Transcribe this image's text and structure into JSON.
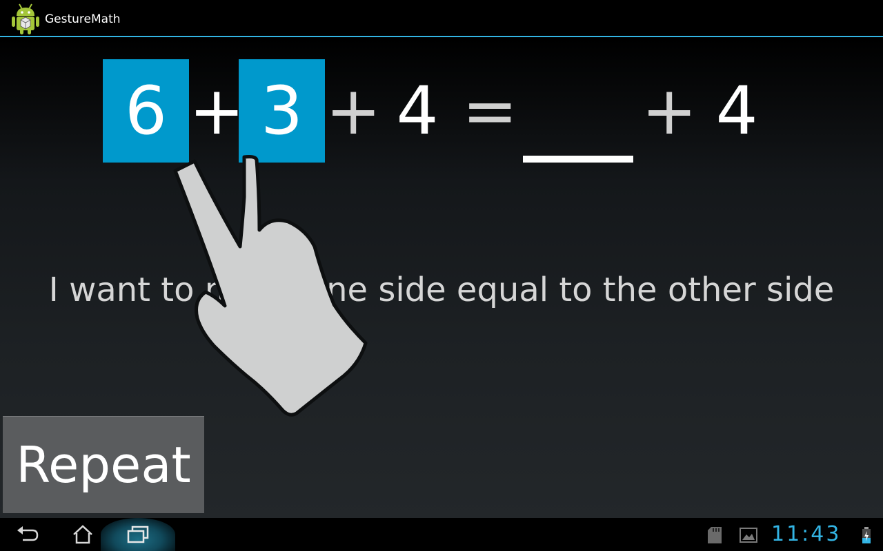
{
  "app": {
    "title": "GestureMath",
    "icon": "android-robot-icon"
  },
  "equation": {
    "tiles": [
      "6",
      "3"
    ],
    "operators": [
      "+",
      "+",
      "+"
    ],
    "numbers": [
      "4",
      "4"
    ],
    "equals": "=",
    "answer": ""
  },
  "prompt": "I want to make one side equal to the other side",
  "repeat_button": {
    "label": "Repeat"
  },
  "status_bar": {
    "clock": "11:43",
    "icons": [
      "sd-card-icon",
      "image-icon",
      "battery-charging-icon"
    ]
  },
  "nav_bar": {
    "icons": [
      "back-icon",
      "home-icon",
      "recents-icon"
    ]
  },
  "colors": {
    "accent": "#33b5e5",
    "tile": "#0099cc",
    "button": "#5a5c5e"
  }
}
